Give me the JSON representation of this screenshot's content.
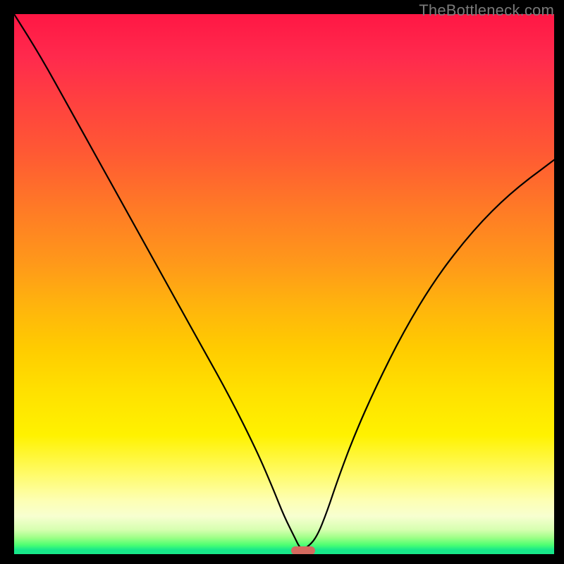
{
  "caption": {
    "text": "TheBottleneck.com"
  },
  "chart_data": {
    "type": "line",
    "title": "",
    "xlabel": "",
    "ylabel": "",
    "xlim": [
      0,
      100
    ],
    "ylim": [
      0,
      100
    ],
    "grid": false,
    "legend": false,
    "series": [
      {
        "name": "bottleneck-curve",
        "x": [
          0,
          5,
          10,
          15,
          20,
          25,
          30,
          35,
          40,
          45,
          48,
          50,
          52,
          53,
          54,
          56,
          58,
          60,
          63,
          67,
          72,
          78,
          85,
          92,
          100
        ],
        "values": [
          100,
          92,
          83,
          74,
          65,
          56,
          47,
          38,
          29,
          19,
          12,
          7,
          3,
          1,
          1,
          3,
          8,
          14,
          22,
          31,
          41,
          51,
          60,
          67,
          73
        ]
      }
    ],
    "annotations": [
      {
        "name": "min-marker",
        "shape": "pill",
        "x": 53.5,
        "y": 0.6,
        "color": "#d46a5f"
      }
    ],
    "background": {
      "type": "vertical-gradient",
      "stops": [
        {
          "pos": 0.0,
          "color": "#ff1744"
        },
        {
          "pos": 0.62,
          "color": "#ffcc00"
        },
        {
          "pos": 0.9,
          "color": "#fdffb3"
        },
        {
          "pos": 0.99,
          "color": "#18e88a"
        }
      ]
    }
  }
}
